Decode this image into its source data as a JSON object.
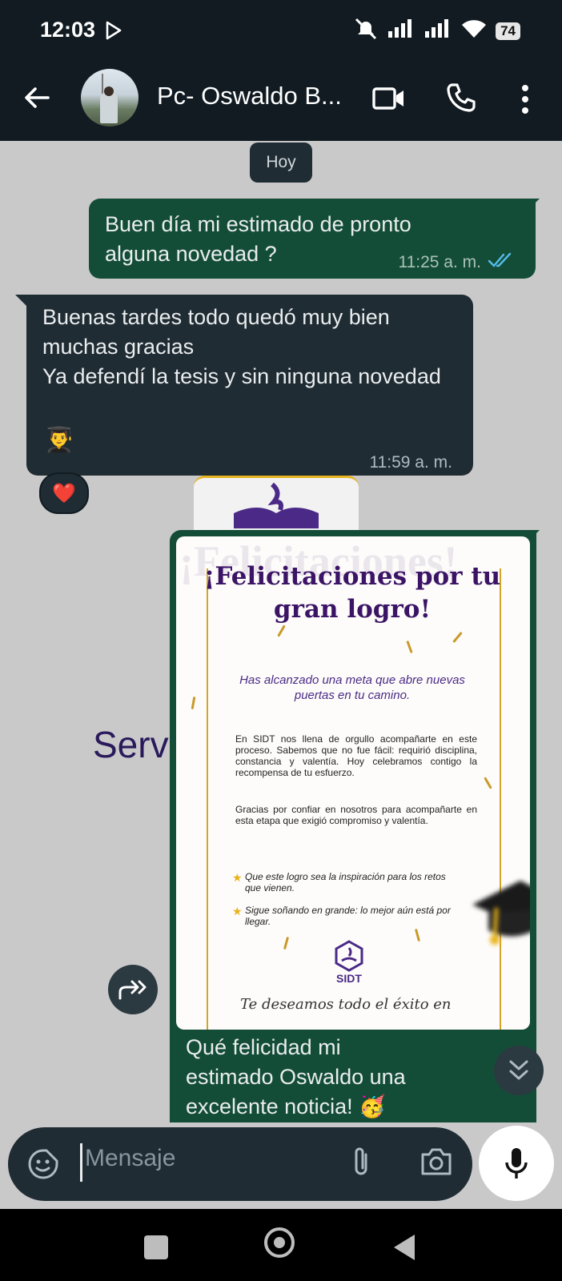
{
  "status_bar": {
    "time": "12:03",
    "battery": "74"
  },
  "header": {
    "contact_name": "Pc- Oswaldo B..."
  },
  "chat": {
    "date_chip": "Hoy",
    "messages": [
      {
        "direction": "out",
        "text": "Buen día mi estimado de pronto alguna novedad ?",
        "time": "11:25 a. m.",
        "status": "read"
      },
      {
        "direction": "in",
        "text": "Buenas tardes todo quedó muy bien muchas gracias\nYa defendí la tesis y sin ninguna novedad",
        "emoji": "👨‍🎓",
        "time": "11:59 a. m.",
        "reaction": "❤️"
      }
    ],
    "background_post_text": "Serv",
    "image_message": {
      "watermark": "¡Felicitaciones!",
      "title": "¡Felicitaciones por tu gran logro!",
      "subtitle": "Has alcanzado una meta que abre nuevas puertas en tu camino.",
      "paragraph_1": "En SIDT nos llena de orgullo acompañarte en este proceso. Sabemos que no fue fácil: requirió disciplina, constancia y valentía. Hoy celebramos contigo la recompensa de tu esfuerzo.",
      "paragraph_2": "Gracias por confiar en nosotros para acompañarte en esta etapa que exigió compromiso y valentía.",
      "bullet_1": "Que este logro sea la inspiración para los retos que vienen.",
      "bullet_2": "Sigue soñando en grande: lo mejor aún está por llegar.",
      "logo_text": "SIDT",
      "footer": "Te deseamos todo el éxito en",
      "caption": "Qué felicidad mi\nestimado Oswaldo una\nexcelente noticia! 🥳"
    }
  },
  "composer": {
    "placeholder": "Mensaje"
  },
  "colors": {
    "header_bg": "#111b21",
    "outgoing_bubble": "#144d37",
    "incoming_bubble": "#202c33",
    "chat_bg": "#c9c9c9"
  }
}
